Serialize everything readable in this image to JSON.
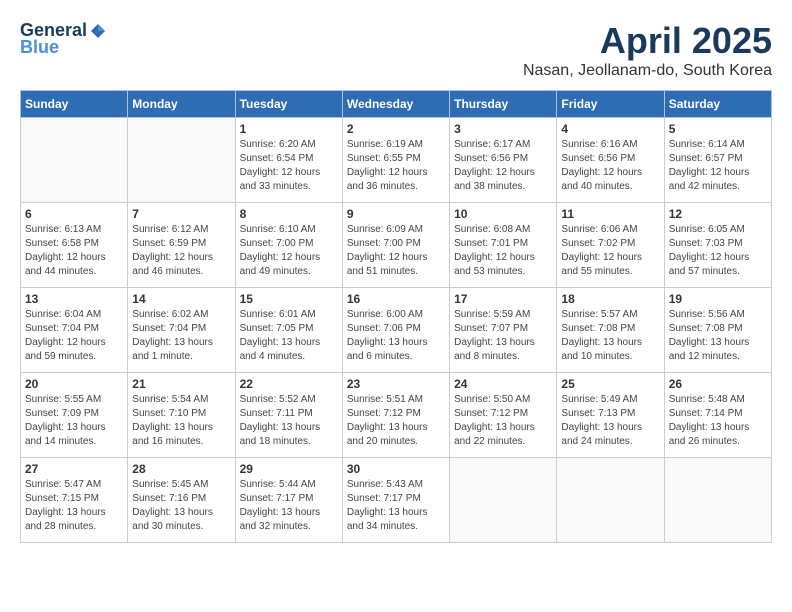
{
  "header": {
    "logo_general": "General",
    "logo_blue": "Blue",
    "month_title": "April 2025",
    "location": "Nasan, Jeollanam-do, South Korea"
  },
  "weekdays": [
    "Sunday",
    "Monday",
    "Tuesday",
    "Wednesday",
    "Thursday",
    "Friday",
    "Saturday"
  ],
  "weeks": [
    [
      {
        "day": "",
        "info": ""
      },
      {
        "day": "",
        "info": ""
      },
      {
        "day": "1",
        "info": "Sunrise: 6:20 AM\nSunset: 6:54 PM\nDaylight: 12 hours\nand 33 minutes."
      },
      {
        "day": "2",
        "info": "Sunrise: 6:19 AM\nSunset: 6:55 PM\nDaylight: 12 hours\nand 36 minutes."
      },
      {
        "day": "3",
        "info": "Sunrise: 6:17 AM\nSunset: 6:56 PM\nDaylight: 12 hours\nand 38 minutes."
      },
      {
        "day": "4",
        "info": "Sunrise: 6:16 AM\nSunset: 6:56 PM\nDaylight: 12 hours\nand 40 minutes."
      },
      {
        "day": "5",
        "info": "Sunrise: 6:14 AM\nSunset: 6:57 PM\nDaylight: 12 hours\nand 42 minutes."
      }
    ],
    [
      {
        "day": "6",
        "info": "Sunrise: 6:13 AM\nSunset: 6:58 PM\nDaylight: 12 hours\nand 44 minutes."
      },
      {
        "day": "7",
        "info": "Sunrise: 6:12 AM\nSunset: 6:59 PM\nDaylight: 12 hours\nand 46 minutes."
      },
      {
        "day": "8",
        "info": "Sunrise: 6:10 AM\nSunset: 7:00 PM\nDaylight: 12 hours\nand 49 minutes."
      },
      {
        "day": "9",
        "info": "Sunrise: 6:09 AM\nSunset: 7:00 PM\nDaylight: 12 hours\nand 51 minutes."
      },
      {
        "day": "10",
        "info": "Sunrise: 6:08 AM\nSunset: 7:01 PM\nDaylight: 12 hours\nand 53 minutes."
      },
      {
        "day": "11",
        "info": "Sunrise: 6:06 AM\nSunset: 7:02 PM\nDaylight: 12 hours\nand 55 minutes."
      },
      {
        "day": "12",
        "info": "Sunrise: 6:05 AM\nSunset: 7:03 PM\nDaylight: 12 hours\nand 57 minutes."
      }
    ],
    [
      {
        "day": "13",
        "info": "Sunrise: 6:04 AM\nSunset: 7:04 PM\nDaylight: 12 hours\nand 59 minutes."
      },
      {
        "day": "14",
        "info": "Sunrise: 6:02 AM\nSunset: 7:04 PM\nDaylight: 13 hours\nand 1 minute."
      },
      {
        "day": "15",
        "info": "Sunrise: 6:01 AM\nSunset: 7:05 PM\nDaylight: 13 hours\nand 4 minutes."
      },
      {
        "day": "16",
        "info": "Sunrise: 6:00 AM\nSunset: 7:06 PM\nDaylight: 13 hours\nand 6 minutes."
      },
      {
        "day": "17",
        "info": "Sunrise: 5:59 AM\nSunset: 7:07 PM\nDaylight: 13 hours\nand 8 minutes."
      },
      {
        "day": "18",
        "info": "Sunrise: 5:57 AM\nSunset: 7:08 PM\nDaylight: 13 hours\nand 10 minutes."
      },
      {
        "day": "19",
        "info": "Sunrise: 5:56 AM\nSunset: 7:08 PM\nDaylight: 13 hours\nand 12 minutes."
      }
    ],
    [
      {
        "day": "20",
        "info": "Sunrise: 5:55 AM\nSunset: 7:09 PM\nDaylight: 13 hours\nand 14 minutes."
      },
      {
        "day": "21",
        "info": "Sunrise: 5:54 AM\nSunset: 7:10 PM\nDaylight: 13 hours\nand 16 minutes."
      },
      {
        "day": "22",
        "info": "Sunrise: 5:52 AM\nSunset: 7:11 PM\nDaylight: 13 hours\nand 18 minutes."
      },
      {
        "day": "23",
        "info": "Sunrise: 5:51 AM\nSunset: 7:12 PM\nDaylight: 13 hours\nand 20 minutes."
      },
      {
        "day": "24",
        "info": "Sunrise: 5:50 AM\nSunset: 7:12 PM\nDaylight: 13 hours\nand 22 minutes."
      },
      {
        "day": "25",
        "info": "Sunrise: 5:49 AM\nSunset: 7:13 PM\nDaylight: 13 hours\nand 24 minutes."
      },
      {
        "day": "26",
        "info": "Sunrise: 5:48 AM\nSunset: 7:14 PM\nDaylight: 13 hours\nand 26 minutes."
      }
    ],
    [
      {
        "day": "27",
        "info": "Sunrise: 5:47 AM\nSunset: 7:15 PM\nDaylight: 13 hours\nand 28 minutes."
      },
      {
        "day": "28",
        "info": "Sunrise: 5:45 AM\nSunset: 7:16 PM\nDaylight: 13 hours\nand 30 minutes."
      },
      {
        "day": "29",
        "info": "Sunrise: 5:44 AM\nSunset: 7:17 PM\nDaylight: 13 hours\nand 32 minutes."
      },
      {
        "day": "30",
        "info": "Sunrise: 5:43 AM\nSunset: 7:17 PM\nDaylight: 13 hours\nand 34 minutes."
      },
      {
        "day": "",
        "info": ""
      },
      {
        "day": "",
        "info": ""
      },
      {
        "day": "",
        "info": ""
      }
    ]
  ]
}
